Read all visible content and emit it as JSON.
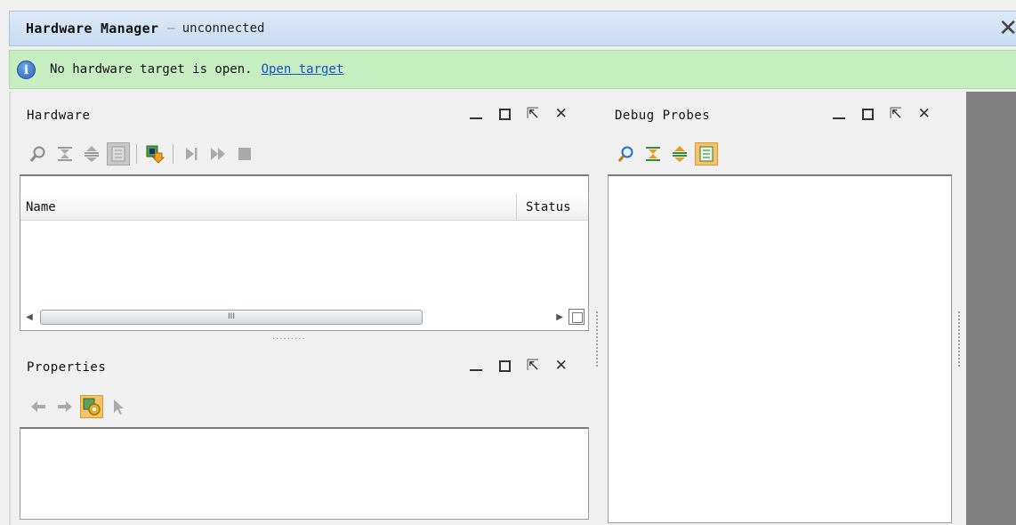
{
  "titlebar": {
    "title": "Hardware Manager",
    "separator": "–",
    "subtitle": "unconnected",
    "close_glyph": "✕"
  },
  "infobar": {
    "icon": "info-icon",
    "icon_glyph": "i",
    "message": "No hardware target is open.",
    "link": "Open target"
  },
  "window_controls": {
    "float_glyph": "⇱",
    "close_glyph": "✕"
  },
  "hardware_panel": {
    "title": "Hardware",
    "toolbar": [
      "search-icon",
      "collapse-all-icon",
      "expand-all-icon",
      "auto-connect-icon",
      "program-device-icon",
      "run-trigger-icon",
      "run-trigger-immediate-icon",
      "stop-trigger-icon"
    ],
    "columns": [
      "Name",
      "Status"
    ],
    "scroll_grip": "III"
  },
  "properties_panel": {
    "title": "Properties",
    "toolbar": [
      "back-arrow-icon",
      "forward-arrow-icon",
      "properties-settings-icon",
      "select-pointer-icon"
    ]
  },
  "debug_probes_panel": {
    "title": "Debug Probes",
    "toolbar": [
      "search-icon",
      "collapse-all-icon",
      "expand-all-icon",
      "show-hierarchy-icon"
    ]
  },
  "colors": {
    "title_bg": "#c9dcf2",
    "info_bg": "#c6eec1",
    "link": "#1a4fc7",
    "selected_tool": "#f6c36b",
    "side_strip": "#808080"
  }
}
